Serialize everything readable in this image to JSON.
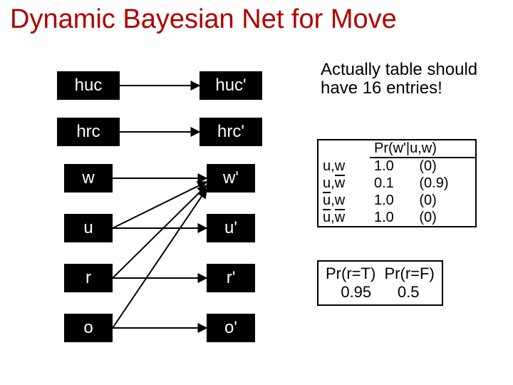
{
  "title": "Dynamic Bayesian Net for Move",
  "nodes": {
    "left": [
      "huc",
      "hrc",
      "w",
      "u",
      "r",
      "o"
    ],
    "right": [
      "huc'",
      "hrc'",
      "w'",
      "u'",
      "r'",
      "o'"
    ]
  },
  "note": "Actually table should have 16 entries!",
  "cpt": {
    "header": {
      "cond": "",
      "prob": "Pr(w'|u,w)",
      "alt": ""
    },
    "rows": [
      {
        "u": "u",
        "w": "w",
        "p": "1.0",
        "q": "(0)"
      },
      {
        "u": "u",
        "w": "w̄",
        "p": "0.1",
        "q": "(0.9)"
      },
      {
        "u": "ū",
        "w": "w",
        "p": "1.0",
        "q": "(0)"
      },
      {
        "u": "ū",
        "w": "w̄",
        "p": "1.0",
        "q": "(0)"
      }
    ]
  },
  "prbox": {
    "l1a": "Pr(r=T)",
    "l1b": "Pr(r=F)",
    "l2a": "0.95",
    "l2b": "0.5"
  }
}
